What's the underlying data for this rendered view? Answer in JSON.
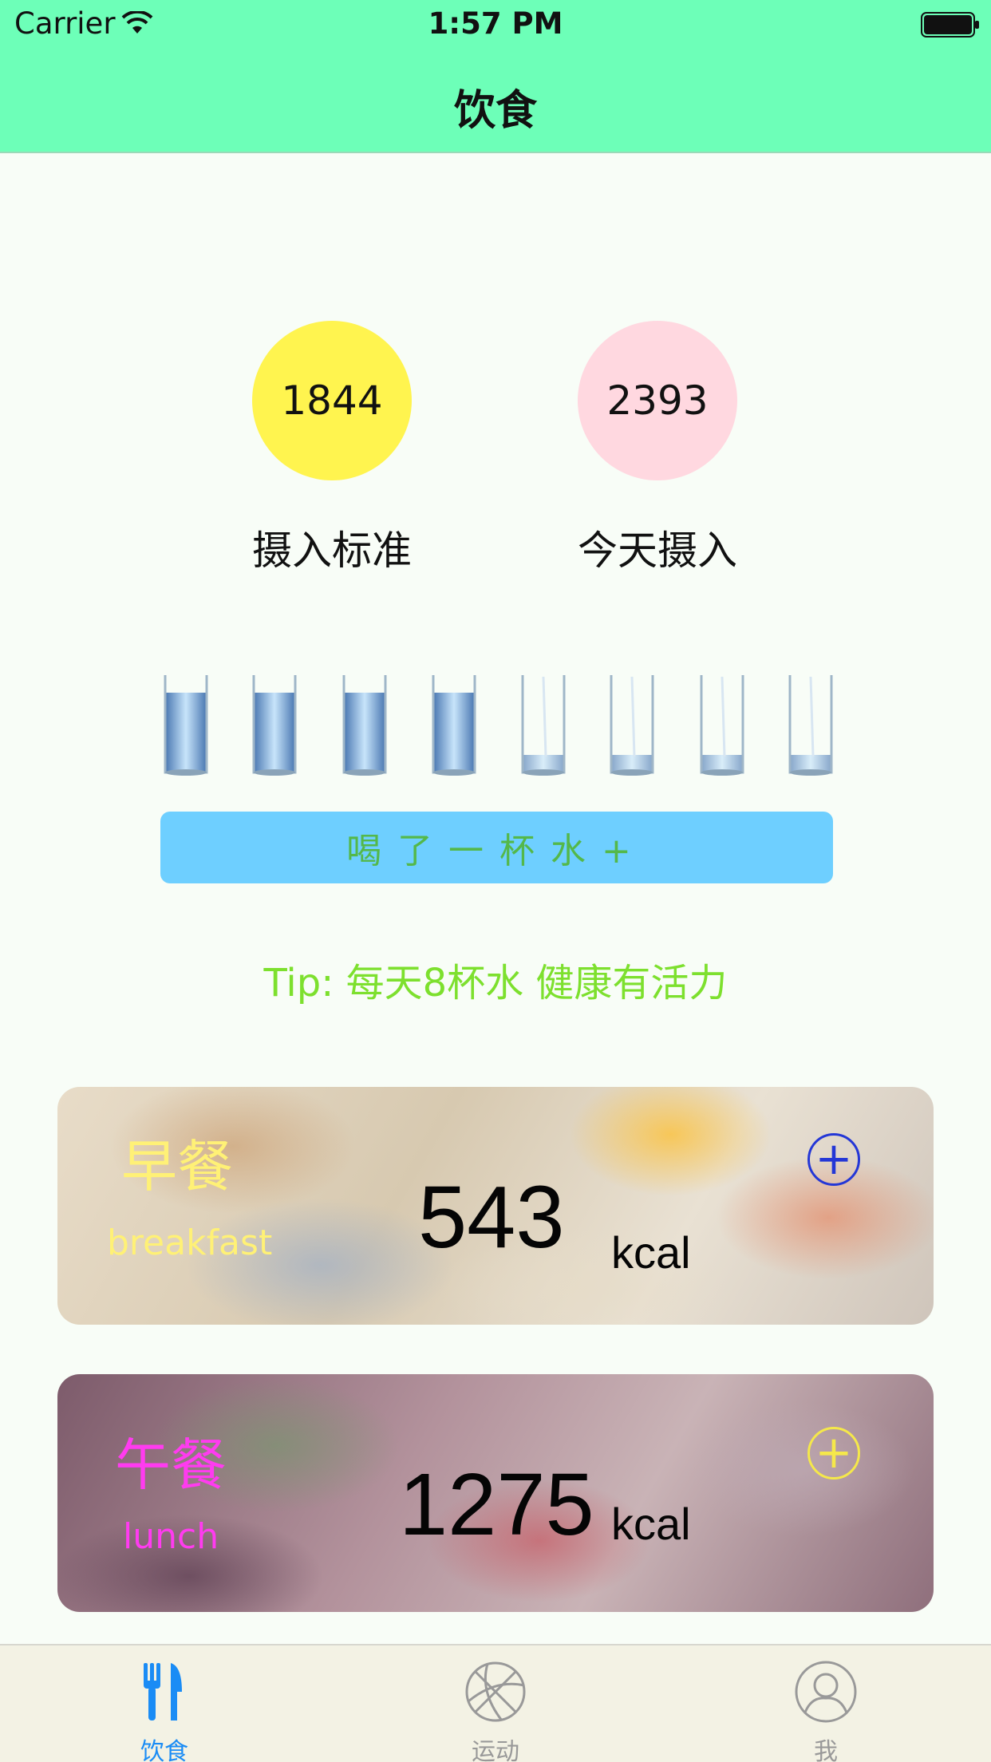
{
  "status_bar": {
    "carrier": "Carrier",
    "time": "1:57 PM"
  },
  "nav": {
    "title": "饮食"
  },
  "intake": {
    "standard_value": "1844",
    "standard_label": "摄入标准",
    "today_value": "2393",
    "today_label": "今天摄入"
  },
  "water": {
    "glasses_total": 8,
    "glasses_filled": 4,
    "button_label": "喝了一杯水+",
    "tip": "Tip: 每天8杯水 健康有活力"
  },
  "meals": [
    {
      "name_cn": "早餐",
      "name_en": "breakfast",
      "kcal": "543",
      "unit": "kcal",
      "name_color": "#fff176",
      "add_icon_color": "#2437d6"
    },
    {
      "name_cn": "午餐",
      "name_en": "lunch",
      "kcal": "1275",
      "unit": "kcal",
      "name_color": "#ff3bf0",
      "add_icon_color": "#f5e84a"
    }
  ],
  "tabbar": {
    "items": [
      {
        "label": "饮食",
        "icon": "fork-knife-icon",
        "active": true
      },
      {
        "label": "运动",
        "icon": "basketball-icon",
        "active": false
      },
      {
        "label": "我",
        "icon": "user-icon",
        "active": false
      }
    ],
    "active_color": "#1a8cf5",
    "inactive_color": "#999999"
  },
  "colors": {
    "nav_background": "#6dffb8",
    "standard_circle": "#fff44f",
    "today_circle": "#ffd8e0",
    "water_button": "#6ecfff",
    "tip_text": "#7de02e"
  }
}
